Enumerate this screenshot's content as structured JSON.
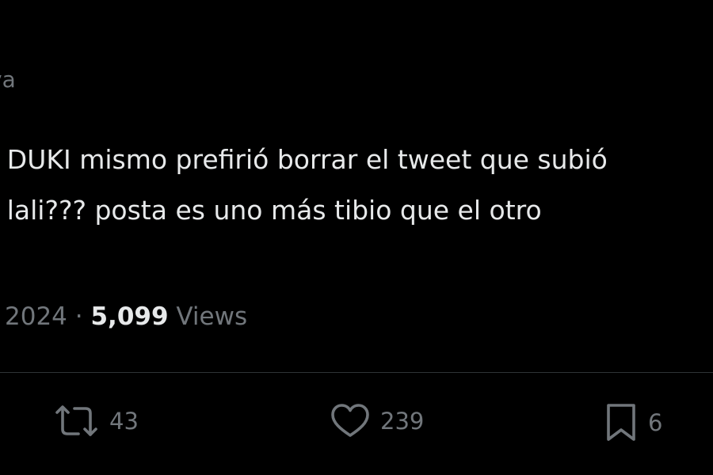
{
  "tweet": {
    "handle_fragment": "va",
    "text_lines": [
      "e DUKI mismo prefirió borrar el tweet que subió",
      "a lali??? posta es uno más tibio que el otro"
    ],
    "date_fragment": "2024",
    "separator": "·",
    "views_count": "5,099",
    "views_label": "Views"
  },
  "actions": {
    "retweet_count": "43",
    "like_count": "239",
    "bookmark_count": "6"
  },
  "colors": {
    "background": "#000000",
    "primary_text": "#e7e9ea",
    "secondary_text": "#71767b",
    "divider": "#2f3336"
  }
}
